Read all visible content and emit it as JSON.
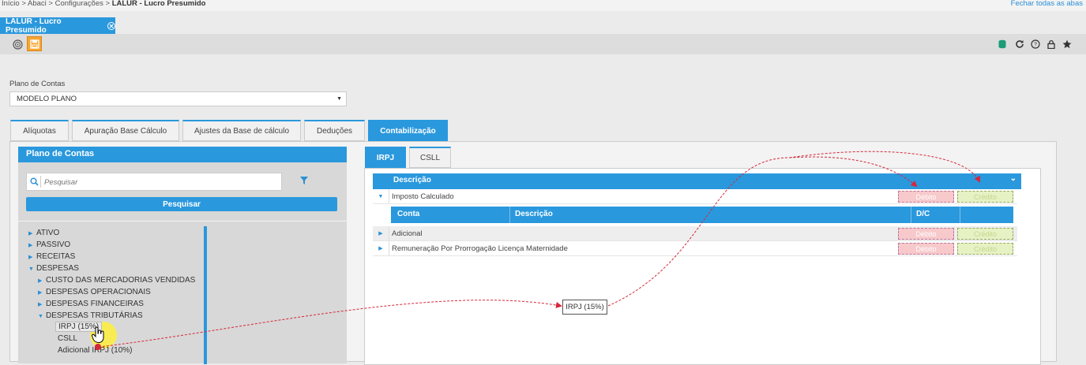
{
  "breadcrumb": {
    "prefix": "Início > Abaci > Configurações > ",
    "current": "LALUR - Lucro Presumido"
  },
  "close_all_tabs": "Fechar todas as abas",
  "window_tab": {
    "label": "LALUR - Lucro Presumido"
  },
  "toolbar": {
    "left_icons": [
      "fingerprint-icon",
      "save-icon"
    ],
    "right_icons": [
      "database-icon",
      "refresh-icon",
      "help-icon",
      "lock-icon",
      "star-icon"
    ]
  },
  "plano_field": {
    "label": "Plano de Contas",
    "value": "MODELO PLANO"
  },
  "tabs": [
    "Alíquotas",
    "Apuração Base Cálculo",
    "Ajustes da Base de cálculo",
    "Deduções",
    "Contabilização"
  ],
  "left_panel": {
    "title": "Plano de Contas",
    "search_placeholder": "Pesquisar",
    "search_button": "Pesquisar",
    "tree": [
      {
        "label": "ATIVO",
        "level": 0,
        "state": "collapsed"
      },
      {
        "label": "PASSIVO",
        "level": 0,
        "state": "collapsed"
      },
      {
        "label": "RECEITAS",
        "level": 0,
        "state": "collapsed"
      },
      {
        "label": "DESPESAS",
        "level": 0,
        "state": "expanded"
      },
      {
        "label": "CUSTO DAS MERCADORIAS VENDIDAS",
        "level": 1,
        "state": "collapsed"
      },
      {
        "label": "DESPESAS OPERACIONAIS",
        "level": 1,
        "state": "collapsed"
      },
      {
        "label": "DESPESAS FINANCEIRAS",
        "level": 1,
        "state": "collapsed"
      },
      {
        "label": "DESPESAS TRIBUTÁRIAS",
        "level": 1,
        "state": "expanded"
      },
      {
        "label": "IRPJ (15%)",
        "level": 2,
        "state": "leaf"
      },
      {
        "label": "CSLL",
        "level": 2,
        "state": "leaf"
      },
      {
        "label": "Adicional IRPJ (10%)",
        "level": 2,
        "state": "leaf"
      }
    ]
  },
  "sub_tabs": [
    "IRPJ",
    "CSLL"
  ],
  "grid": {
    "header": "Descrição",
    "rows": [
      {
        "label": "Imposto Calculado",
        "debit": "Débito",
        "credit": "Crédito"
      },
      {
        "label": "Adicional",
        "debit": "Débito",
        "credit": "Crédito"
      },
      {
        "label": "Remuneração Por Prorrogação Licença Maternidade",
        "debit": "Débito",
        "credit": "Crédito"
      }
    ],
    "sub_columns": [
      "Conta",
      "Descrição",
      "D/C"
    ]
  },
  "drag_tooltip": "IRPJ (15%)",
  "colors": {
    "accent": "#2a98dd",
    "debit": "#f7c9cb",
    "credit": "#e6f2c4",
    "drag_line": "#d6263a"
  }
}
